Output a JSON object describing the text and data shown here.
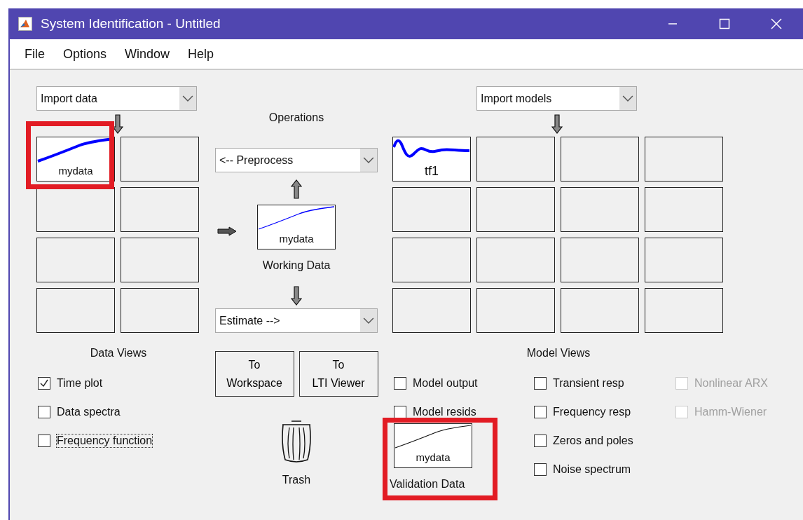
{
  "window": {
    "title": "System Identification - Untitled"
  },
  "menu": [
    "File",
    "Options",
    "Window",
    "Help"
  ],
  "data_panel": {
    "import": "Import data",
    "slots": [
      {
        "kind": "data",
        "label": "mydata",
        "highlighted": true
      },
      {
        "kind": "empty"
      },
      {
        "kind": "empty"
      },
      {
        "kind": "empty"
      },
      {
        "kind": "empty"
      },
      {
        "kind": "empty"
      },
      {
        "kind": "empty"
      },
      {
        "kind": "empty"
      }
    ]
  },
  "operations": {
    "title": "Operations",
    "preprocess": "<-- Preprocess",
    "working_data": {
      "label": "mydata",
      "caption": "Working Data"
    },
    "estimate": "Estimate -->"
  },
  "model_panel": {
    "import": "Import models",
    "slots": [
      {
        "kind": "model",
        "label": "tf1"
      },
      {
        "kind": "empty"
      },
      {
        "kind": "empty"
      },
      {
        "kind": "empty"
      },
      {
        "kind": "empty"
      },
      {
        "kind": "empty"
      },
      {
        "kind": "empty"
      },
      {
        "kind": "empty"
      },
      {
        "kind": "empty"
      },
      {
        "kind": "empty"
      },
      {
        "kind": "empty"
      },
      {
        "kind": "empty"
      },
      {
        "kind": "empty"
      },
      {
        "kind": "empty"
      },
      {
        "kind": "empty"
      },
      {
        "kind": "empty"
      }
    ]
  },
  "data_views": {
    "title": "Data Views",
    "options": [
      {
        "label": "Time plot",
        "checked": true,
        "focused": false
      },
      {
        "label": "Data spectra",
        "checked": false,
        "focused": false
      },
      {
        "label": "Frequency function",
        "checked": false,
        "focused": true
      }
    ]
  },
  "buttons": [
    {
      "lines": [
        "To",
        "Workspace"
      ]
    },
    {
      "lines": [
        "To",
        "LTI Viewer"
      ]
    }
  ],
  "trash": {
    "label": "Trash"
  },
  "model_views": {
    "title": "Model Views",
    "validation_data": {
      "label": "mydata",
      "caption": "Validation Data",
      "highlighted": true
    },
    "columns": [
      [
        {
          "label": "Model output",
          "checked": false,
          "disabled": false
        },
        {
          "label": "Model resids",
          "checked": false,
          "disabled": false
        }
      ],
      [
        {
          "label": "Transient resp",
          "checked": false,
          "disabled": false
        },
        {
          "label": "Frequency resp",
          "checked": false,
          "disabled": false
        },
        {
          "label": "Zeros and poles",
          "checked": false,
          "disabled": false
        },
        {
          "label": "Noise spectrum",
          "checked": false,
          "disabled": false
        }
      ],
      [
        {
          "label": "Nonlinear ARX",
          "checked": false,
          "disabled": true
        },
        {
          "label": "Hamm-Wiener",
          "checked": false,
          "disabled": true
        }
      ]
    ]
  }
}
